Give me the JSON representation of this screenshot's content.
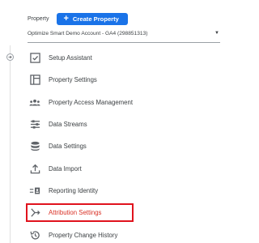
{
  "header": {
    "property_label": "Property",
    "create_button_label": "Create Property",
    "create_button_icon": "plus-icon"
  },
  "account_selector": {
    "value": "Optimize Smart Demo Account - GA4 (298851313)",
    "icon": "caret-down-icon"
  },
  "collapse_toggle": {
    "icon": "arrow-right-icon"
  },
  "menu": {
    "items": [
      {
        "label": "Setup Assistant",
        "icon": "checkbox-icon"
      },
      {
        "label": "Property Settings",
        "icon": "settings-panel-icon"
      },
      {
        "label": "Property Access Management",
        "icon": "people-icon"
      },
      {
        "label": "Data Streams",
        "icon": "streams-icon"
      },
      {
        "label": "Data Settings",
        "icon": "database-icon"
      },
      {
        "label": "Data Import",
        "icon": "upload-icon"
      },
      {
        "label": "Reporting Identity",
        "icon": "identity-icon"
      },
      {
        "label": "Attribution Settings",
        "icon": "attribution-icon",
        "highlighted": true
      },
      {
        "label": "Property Change History",
        "icon": "history-icon"
      }
    ]
  },
  "colors": {
    "accent": "#1a73e8",
    "highlight_border": "#e0131d",
    "highlight_text": "#d93025",
    "icon": "#5f6368"
  }
}
